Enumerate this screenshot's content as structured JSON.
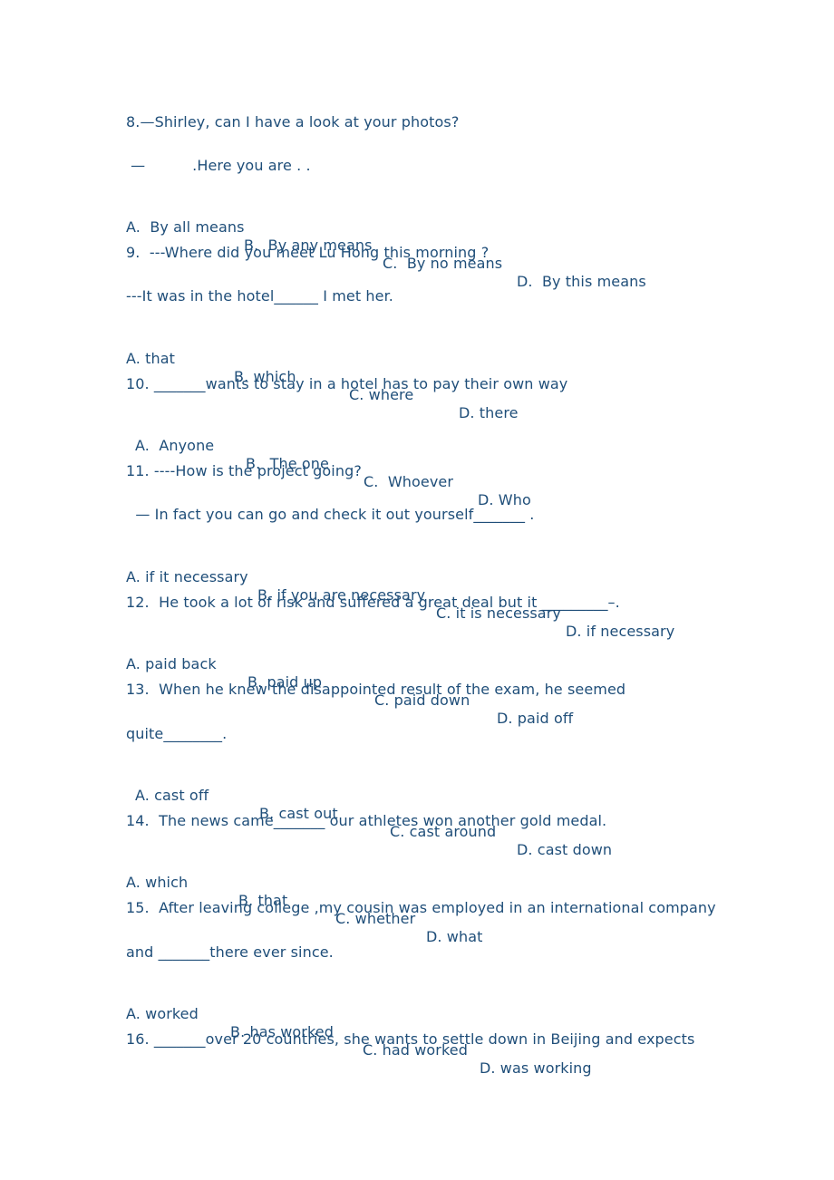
{
  "document": {
    "questions": [
      {
        "number": "8",
        "lines": [
          "8.—Shirley, can I have a look at your photos?",
          " —          .Here you are . ."
        ],
        "options": [
          "A.  By all means",
          "B.  By any means",
          "C.  By no means",
          "D.  By this means"
        ]
      },
      {
        "number": "9",
        "lines": [
          "9.  ---Where did you meet Lu Hong this morning ?",
          "---It was in the hotel______ I met her."
        ],
        "options": [
          "A. that",
          "B. which",
          "C. where",
          "D. there"
        ]
      },
      {
        "number": "10",
        "lines": [
          "10. _______wants to stay in a hotel has to pay their own way"
        ],
        "options": [
          "A.  Anyone",
          "B.  The one",
          "C.  Whoever",
          "D. Who"
        ]
      },
      {
        "number": "11",
        "lines": [
          "11. ----How is the project going?",
          "  — In fact you can go and check it out yourself_______ ."
        ],
        "options": [
          "A. if it necessary",
          "B. if you are necessary",
          "C. it is necessary",
          "D. if necessary"
        ]
      },
      {
        "number": "12",
        "lines": [
          "12.  He took a lot of risk and suffered a great deal but it _________–."
        ],
        "options": [
          "A. paid back",
          "B. paid up",
          "C. paid down",
          "D. paid off"
        ]
      },
      {
        "number": "13",
        "lines": [
          "13.  When he knew the disappointed result of the exam, he seemed",
          "quite________."
        ],
        "options": [
          "A. cast off",
          "B. cast out",
          "C. cast around",
          "D. cast down"
        ]
      },
      {
        "number": "14",
        "lines": [
          "14.  The news came_______ our athletes won another gold medal."
        ],
        "options": [
          "A. which",
          "B. that",
          "C. whether",
          "D. what"
        ]
      },
      {
        "number": "15",
        "lines": [
          "15.  After leaving college ,my cousin was employed in an international company",
          "and _______there ever since."
        ],
        "options": [
          "A. worked",
          "B. has worked",
          "C. had worked",
          "D. was working"
        ]
      },
      {
        "number": "16",
        "lines": [
          "16. _______over 20 countries, she wants to settle down in Beijing and expects"
        ],
        "options": []
      }
    ]
  }
}
